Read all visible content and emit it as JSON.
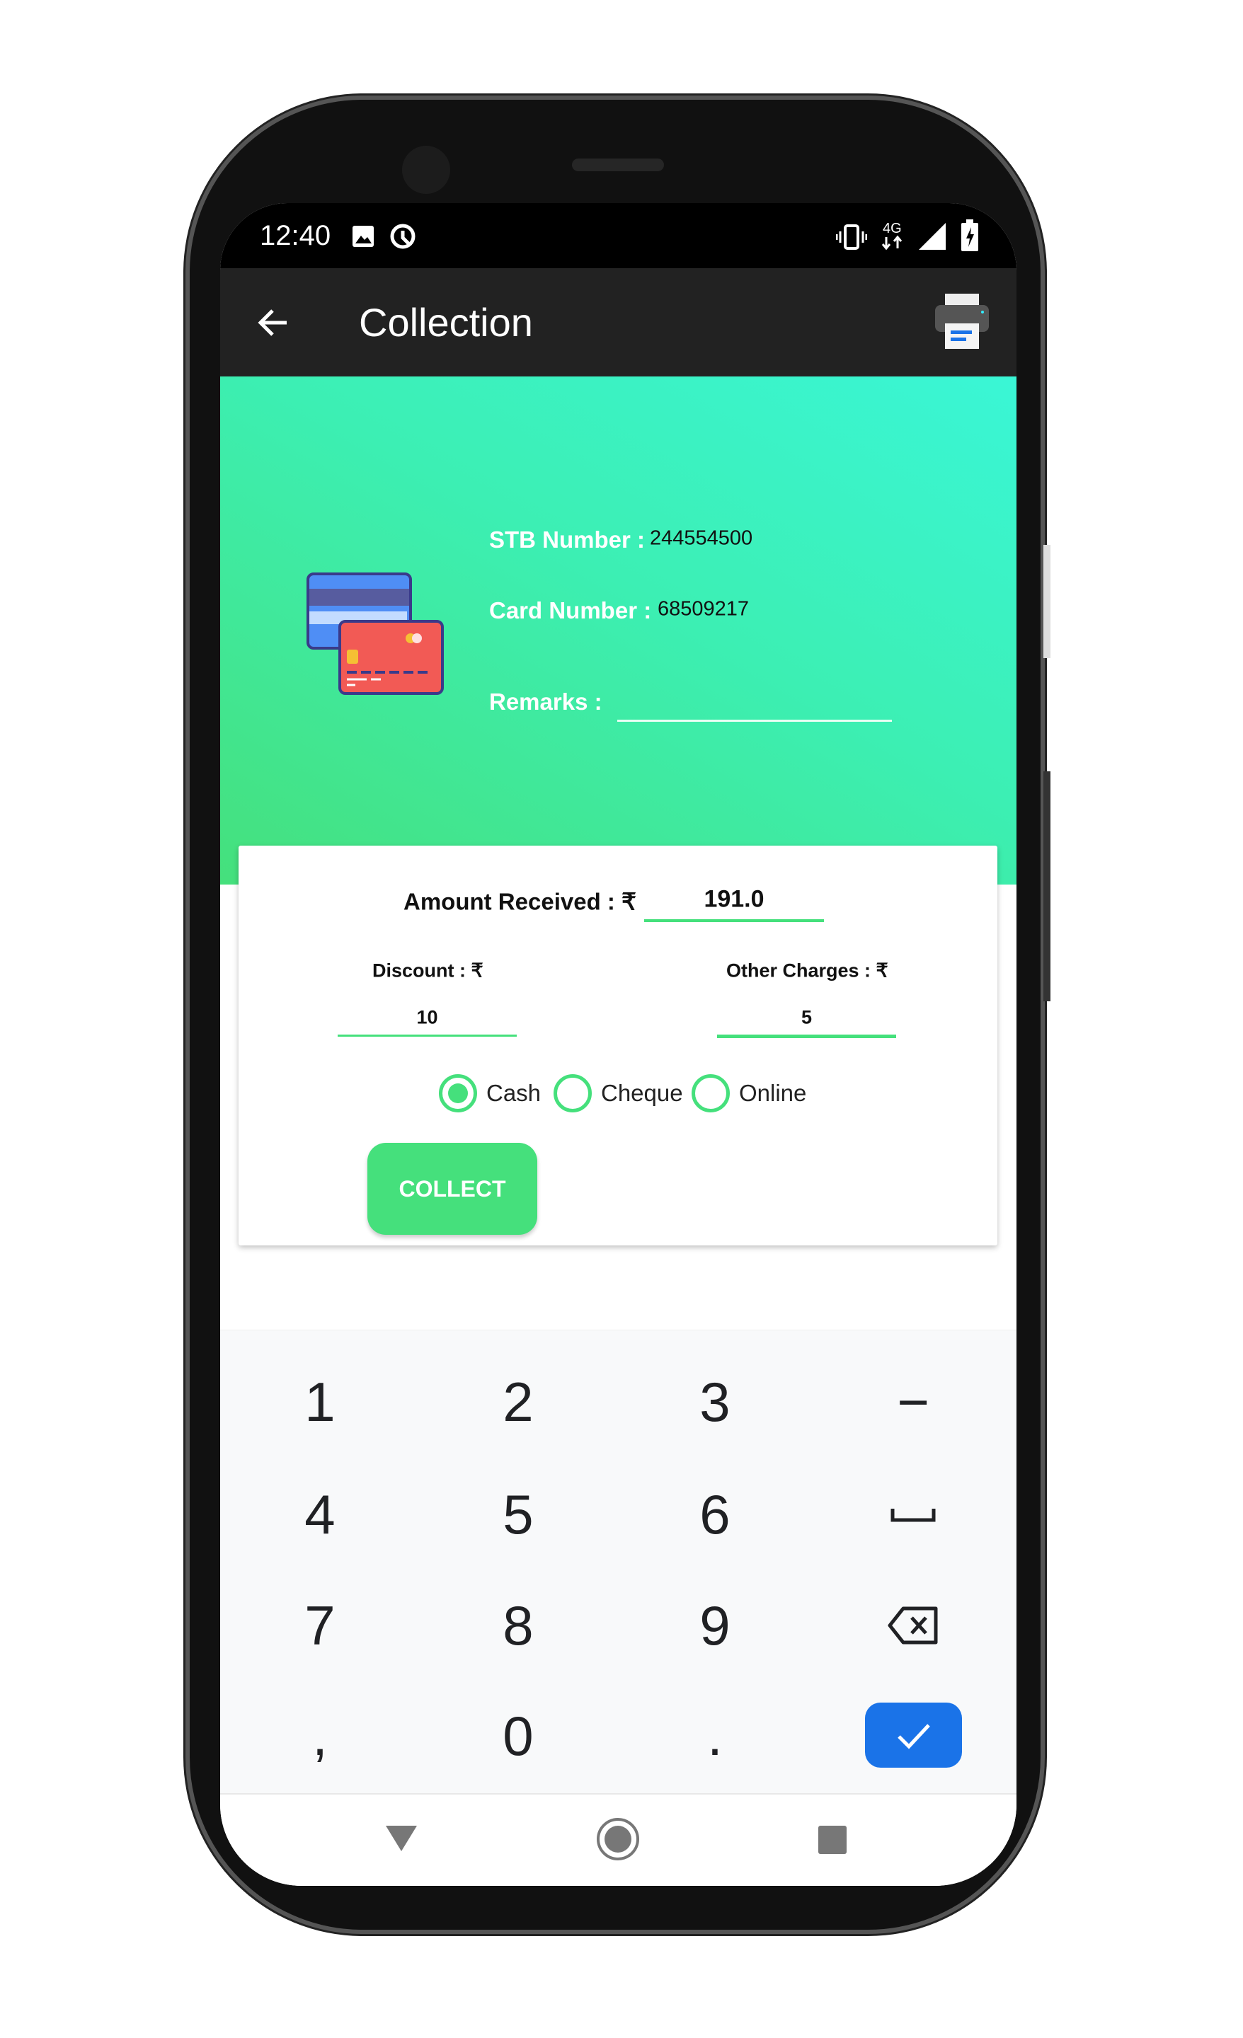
{
  "status_bar": {
    "time": "12:40",
    "icons": [
      "image-icon",
      "data-saver-icon",
      "vibrate-icon",
      "4g-icon",
      "signal-icon",
      "battery-charging-icon"
    ],
    "network": "4G"
  },
  "app_bar": {
    "title": "Collection",
    "back_icon": "arrow-left-icon",
    "action_icon": "printer-icon"
  },
  "header": {
    "illustration": "credit-cards-icon",
    "stb_label": "STB Number :",
    "stb_value": "244554500",
    "card_label": "Card Number :",
    "card_value": "68509217",
    "remarks_label": "Remarks :",
    "remarks_value": ""
  },
  "form": {
    "amount_label": "Amount Received : ₹",
    "amount_value": "191.0",
    "discount_label": "Discount : ₹",
    "discount_value": "10",
    "other_label": "Other Charges : ₹",
    "other_value": "5",
    "payment_modes": [
      {
        "label": "Cash",
        "selected": true
      },
      {
        "label": "Cheque",
        "selected": false
      },
      {
        "label": "Online",
        "selected": false
      }
    ],
    "collect_label": "COLLECT"
  },
  "keyboard": {
    "keys": [
      "1",
      "2",
      "3",
      "−",
      "4",
      "5",
      "6",
      "␣",
      "7",
      "8",
      "9",
      "⌫",
      ",",
      "0",
      ".",
      "✓"
    ]
  },
  "colors": {
    "accent": "#45e07c",
    "teal": "#3af6d6",
    "appbar": "#222222",
    "enter_key": "#1a73e8"
  }
}
